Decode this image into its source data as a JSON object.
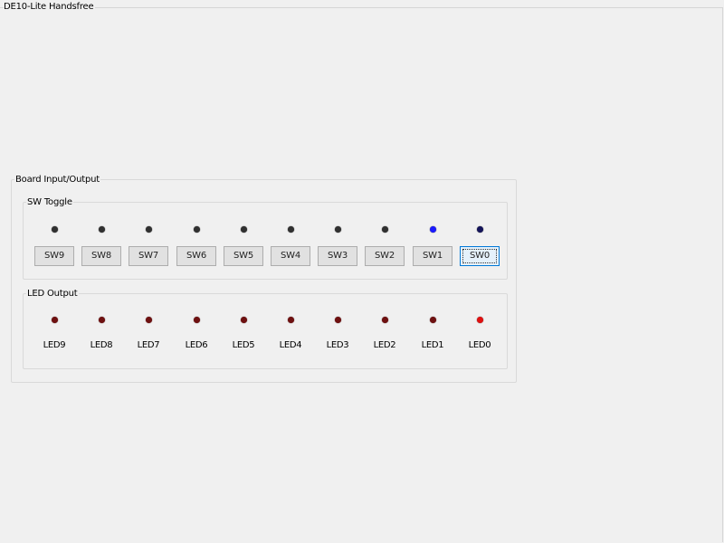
{
  "window": {
    "title": "DE10-Lite Handsfree"
  },
  "board_group": {
    "label": "Board Input/Output"
  },
  "sw_group": {
    "label": "SW Toggle",
    "switches": [
      {
        "label": "SW9",
        "indicator_color": "#303030"
      },
      {
        "label": "SW8",
        "indicator_color": "#303030"
      },
      {
        "label": "SW7",
        "indicator_color": "#303030"
      },
      {
        "label": "SW6",
        "indicator_color": "#303030"
      },
      {
        "label": "SW5",
        "indicator_color": "#303030"
      },
      {
        "label": "SW4",
        "indicator_color": "#303030"
      },
      {
        "label": "SW3",
        "indicator_color": "#303030"
      },
      {
        "label": "SW2",
        "indicator_color": "#303030"
      },
      {
        "label": "SW1",
        "indicator_color": "#1a1aff"
      },
      {
        "label": "SW0",
        "indicator_color": "#14145a"
      }
    ],
    "focused_switch": "SW0"
  },
  "led_group": {
    "label": "LED Output",
    "leds": [
      {
        "label": "LED9",
        "color": "#6e1010"
      },
      {
        "label": "LED8",
        "color": "#6e1010"
      },
      {
        "label": "LED7",
        "color": "#6e1010"
      },
      {
        "label": "LED6",
        "color": "#6e1010"
      },
      {
        "label": "LED5",
        "color": "#6e1010"
      },
      {
        "label": "LED4",
        "color": "#6e1010"
      },
      {
        "label": "LED3",
        "color": "#6e1010"
      },
      {
        "label": "LED2",
        "color": "#6e1010"
      },
      {
        "label": "LED1",
        "color": "#6e1010"
      },
      {
        "label": "LED0",
        "color": "#e01010"
      }
    ]
  }
}
